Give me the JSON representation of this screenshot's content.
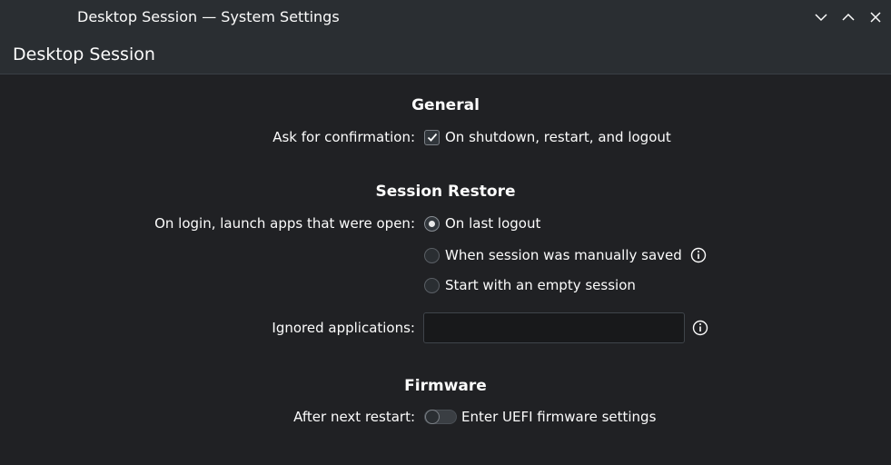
{
  "window": {
    "title": "Desktop Session — System Settings",
    "icons": {
      "minimize": "chevron-down-icon",
      "maximize": "chevron-up-icon",
      "close": "close-icon"
    }
  },
  "header": {
    "title": "Desktop Session"
  },
  "general": {
    "heading": "General",
    "confirm_label": "Ask for confirmation:",
    "confirm_option": "On shutdown, restart, and logout",
    "confirm_checked": true
  },
  "session_restore": {
    "heading": "Session Restore",
    "launch_label": "On login, launch apps that were open:",
    "options": [
      {
        "label": "On last logout",
        "checked": true
      },
      {
        "label": "When session was manually saved",
        "checked": false
      },
      {
        "label": "Start with an empty session",
        "checked": false
      }
    ],
    "ignored_label": "Ignored applications:",
    "ignored_value": "",
    "ignored_placeholder": ""
  },
  "firmware": {
    "heading": "Firmware",
    "restart_label": "After next restart:",
    "restart_option": "Enter UEFI firmware settings",
    "restart_enabled": false
  },
  "colors": {
    "background": "#202124",
    "titlebar": "#2a2e32",
    "text": "#fcfcfc"
  }
}
